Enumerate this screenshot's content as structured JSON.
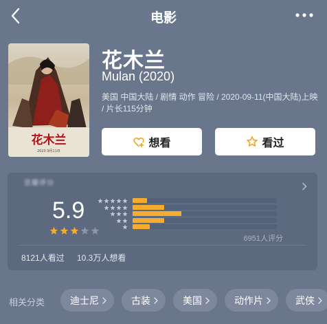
{
  "nav": {
    "title": "电影",
    "back_icon": "chevron-left-icon",
    "more_icon": "more-dots-icon"
  },
  "movie": {
    "title_cn": "花木兰",
    "title_en": "Mulan (2020)",
    "meta": "美国 中国大陆 / 剧情 动作 冒险 / 2020-09-11(中国大陆)上映 / 片长115分钟",
    "poster": {
      "title_text": "花木兰",
      "date_text": "2020 9月11日"
    }
  },
  "actions": {
    "want": {
      "label": "想看",
      "icon": "heart-plus-icon"
    },
    "seen": {
      "label": "看过",
      "icon": "star-outline-icon"
    }
  },
  "rating": {
    "source_label": "豆瓣评分",
    "score": "5.9",
    "stars_value": 3,
    "stars_max": 5,
    "distribution": [
      {
        "stars": 5,
        "fraction": 0.1
      },
      {
        "stars": 4,
        "fraction": 0.22
      },
      {
        "stars": 3,
        "fraction": 0.34
      },
      {
        "stars": 2,
        "fraction": 0.22
      },
      {
        "stars": 1,
        "fraction": 0.12
      }
    ],
    "vote_count": "6951人评分",
    "watched": "8121人看过",
    "wanted": "10.3万人想看"
  },
  "tags": {
    "label": "相关分类",
    "items": [
      {
        "label": "迪士尼"
      },
      {
        "label": "古装"
      },
      {
        "label": "美国"
      },
      {
        "label": "动作片"
      },
      {
        "label": "武侠"
      }
    ]
  },
  "colors": {
    "background": "#6a768c",
    "card": "#5d697f",
    "accent": "#f8ac2d",
    "tag": "#7d889c"
  }
}
